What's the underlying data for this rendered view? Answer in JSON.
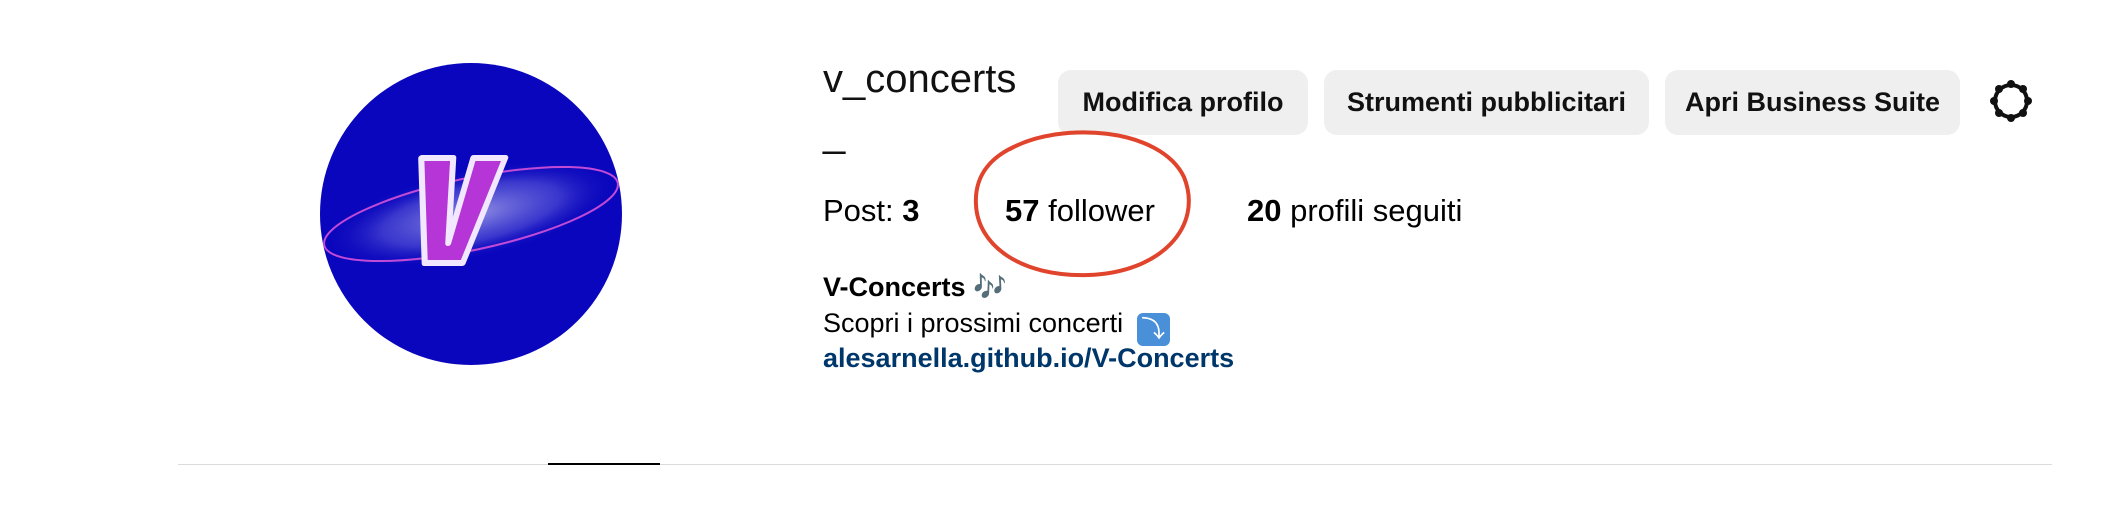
{
  "profile": {
    "username": "v_concerts_",
    "avatar_letter": "V",
    "colors": {
      "avatar_bg": "#0a06bd",
      "avatar_letter": "#b535d6",
      "link": "#00376b",
      "highlight": "#e0442c"
    }
  },
  "actions": {
    "edit_profile": "Modifica profilo",
    "ad_tools": "Strumenti pubblicitari",
    "business_suite": "Apri Business Suite",
    "settings_icon": "gear-icon"
  },
  "stats": {
    "posts_label": "Post:",
    "posts_value": "3",
    "followers_value": "57",
    "followers_label": "follower",
    "following_value": "20",
    "following_label": "profili seguiti"
  },
  "bio": {
    "name": "V-Concerts 🎶",
    "description": "Scopri i prossimi concerti",
    "description_emoji": "⤵",
    "link": "alesarnella.github.io/V-Concerts"
  }
}
